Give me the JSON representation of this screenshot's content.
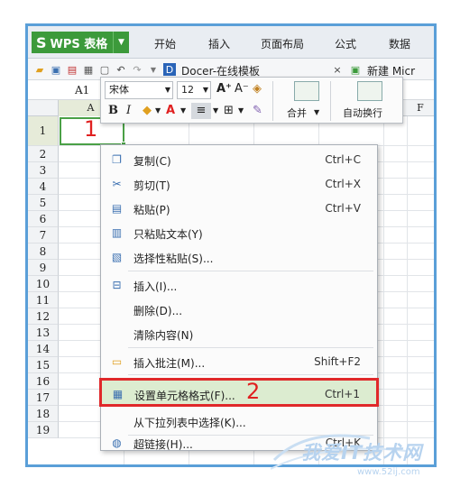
{
  "app": {
    "title": "WPS 表格"
  },
  "menu_tabs": [
    "开始",
    "插入",
    "页面布局",
    "公式",
    "数据"
  ],
  "doc_tabs": {
    "current": "Docer-在线模板",
    "new": "新建 Micr"
  },
  "name_box": "A1",
  "columns": {
    "a": "A",
    "f": "F"
  },
  "rows": [
    "1",
    "2",
    "3",
    "4",
    "5",
    "6",
    "7",
    "8",
    "9",
    "10",
    "11",
    "12",
    "13",
    "14",
    "15",
    "16",
    "17",
    "18",
    "19"
  ],
  "annotations": {
    "one": "1",
    "two": "2"
  },
  "mini_toolbar": {
    "font_name": "宋体",
    "font_size": "12",
    "grow": "A⁺",
    "shrink": "A⁻",
    "bold": "B",
    "italic": "I",
    "merge": "合并",
    "wrap": "自动换行"
  },
  "context_menu": [
    {
      "label": "复制(C)",
      "shortcut": "Ctrl+C"
    },
    {
      "label": "剪切(T)",
      "shortcut": "Ctrl+X"
    },
    {
      "label": "粘贴(P)",
      "shortcut": "Ctrl+V"
    },
    {
      "label": "只粘贴文本(Y)",
      "shortcut": ""
    },
    {
      "label": "选择性粘贴(S)...",
      "shortcut": ""
    },
    {
      "label": "插入(I)...",
      "shortcut": ""
    },
    {
      "label": "删除(D)...",
      "shortcut": ""
    },
    {
      "label": "清除内容(N)",
      "shortcut": ""
    },
    {
      "label": "插入批注(M)...",
      "shortcut": "Shift+F2"
    },
    {
      "label": "设置单元格格式(F)...",
      "shortcut": "Ctrl+1"
    },
    {
      "label": "从下拉列表中选择(K)...",
      "shortcut": ""
    },
    {
      "label": "超链接(H)...",
      "shortcut": "Ctrl+K"
    }
  ],
  "watermark": {
    "text": "我爱IT技术网",
    "url": "www.52ij.com"
  },
  "colors": {
    "accent_green": "#3c9a3b",
    "highlight_red": "#e0282a",
    "frame_blue": "#5a9fd8"
  }
}
